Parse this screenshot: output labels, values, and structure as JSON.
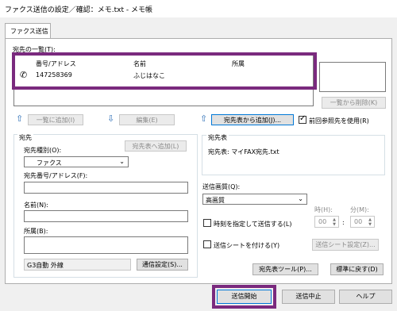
{
  "window": {
    "title": "ファクス送信の設定／確認：メモ.txt - メモ帳"
  },
  "tab": {
    "label": "ファクス送信"
  },
  "recipients": {
    "label": "宛先の一覧(T):",
    "columns": [
      "番号/アドレス",
      "名前",
      "所属"
    ],
    "rows": [
      {
        "number": "147258369",
        "name": "ふじはなこ",
        "affiliation": ""
      }
    ],
    "delete_from_list": "一覧から削除(K)"
  },
  "actions": {
    "add_to_list": "一覧に追加(I)",
    "edit": "編集(E)",
    "add_from_addressbook": "宛先表から追加(J)...",
    "use_previous": "前回参照先を使用(R)"
  },
  "destination": {
    "group_label": "宛先",
    "add_to_addressbook": "宛先表へ追加(L)",
    "type_label": "宛先種別(O):",
    "type_value": "ファクス",
    "number_label": "宛先番号/アドレス(F):",
    "number_value": "",
    "name_label": "名前(N):",
    "name_value": "",
    "affiliation_label": "所属(B):",
    "affiliation_value": "",
    "line_value": "G3自動 外線",
    "comm_settings": "通信設定(S)..."
  },
  "addressbook": {
    "group_label": "宛先表",
    "value": "宛先表: マイFAX宛先.txt"
  },
  "quality": {
    "label": "送信画質(Q):",
    "value": "高画質"
  },
  "timer": {
    "label": "時刻を指定して送信する(L)",
    "hour_label": "時(H):",
    "minute_label": "分(M):",
    "hour_value": "00",
    "minute_value": "00",
    "sep": ":"
  },
  "cover": {
    "label": "送信シートを付ける(Y)",
    "settings": "送信シート設定(Z)..."
  },
  "tools": {
    "addressbook_tool": "宛先表ツール(P)...",
    "restore_default": "標準に戻す(D)"
  },
  "footer": {
    "send": "送信開始",
    "cancel": "送信中止",
    "help": "ヘルプ"
  },
  "colors": {
    "highlight": "#7a2a7e",
    "accent": "#0078d7"
  }
}
